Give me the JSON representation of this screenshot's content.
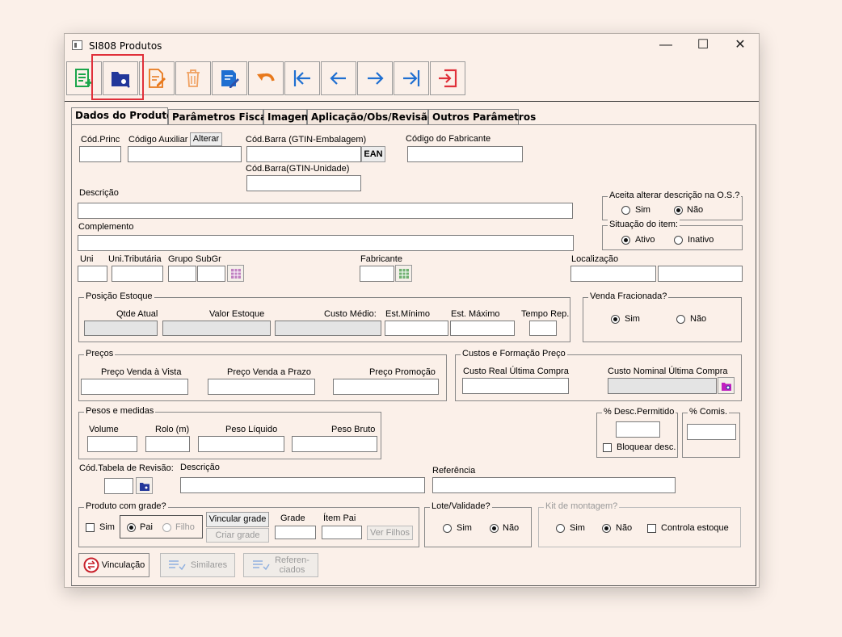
{
  "window": {
    "title": "SI808 Produtos",
    "minimize": "—",
    "maximize": "☐",
    "close": "✕"
  },
  "toolbar": {
    "icons": [
      "new-icon",
      "search-folder-icon",
      "edit-icon",
      "delete-icon",
      "edit-save-icon",
      "undo-icon",
      "first-icon",
      "previous-icon",
      "next-icon",
      "last-icon",
      "exit-icon"
    ]
  },
  "tabs": [
    "Dados do  Produto",
    "Parâmetros Fiscais",
    "Imagem",
    "Aplicação/Obs/Revisão",
    "Outros Parâmetros"
  ],
  "top": {
    "cod_princ": "Cód.Princ",
    "cod_aux": "Código Auxiliar",
    "alterar": "Alterar",
    "cod_barra_emb": "Cód.Barra (GTIN-Embalagem)",
    "ean": "EAN",
    "cod_barra_uni": "Cód.Barra(GTIN-Unidade)",
    "cod_fabricante": "Código do Fabricante",
    "descricao": "Descrição",
    "complemento": "Complemento"
  },
  "aceita": {
    "title": "Aceita alterar descrição na O.S.?",
    "sim": "Sim",
    "nao": "Não"
  },
  "situacao": {
    "title": "Situação do item:",
    "ativo": "Ativo",
    "inativo": "Inativo"
  },
  "row3": {
    "uni": "Uni",
    "uni_trib": "Uni.Tributária",
    "grupo": "Grupo",
    "subgr": "SubGr",
    "fabricante": "Fabricante",
    "localizacao": "Localização"
  },
  "estoque": {
    "title": "Posição Estoque",
    "qtde": "Qtde Atual",
    "valor": "Valor Estoque",
    "custo_medio": "Custo Médio:",
    "est_min": "Est.Mínimo",
    "est_max": "Est. Máximo",
    "tempo_rep": "Tempo Rep."
  },
  "venda_frac": {
    "title": "Venda Fracionada?",
    "sim": "Sim",
    "nao": "Não"
  },
  "precos": {
    "title": "Preços",
    "vista": "Preço Venda à Vista",
    "prazo": "Preço Venda a Prazo",
    "promo": "Preço Promoção"
  },
  "custos": {
    "title": "Custos e Formação Preço",
    "real": "Custo Real Última Compra",
    "nominal": "Custo Nominal Última Compra"
  },
  "pesos": {
    "title": "Pesos e medidas",
    "volume": "Volume",
    "rolo": "Rolo (m)",
    "liquido": "Peso Líquido",
    "bruto": "Peso Bruto"
  },
  "desc_perm": {
    "title": "% Desc.Permitido",
    "bloquear": "Bloquear desc."
  },
  "comis": {
    "title": "% Comis."
  },
  "revisao": {
    "cod_tabela": "Cód.Tabela de Revisão:",
    "descricao": "Descrição",
    "referencia": "Referência"
  },
  "grade": {
    "title": "Produto com grade?",
    "sim": "Sim",
    "pai": "Pai",
    "filho": "Filho",
    "vincular": "Vincular grade",
    "criar": "Criar grade",
    "grade": "Grade",
    "item_pai": "Ítem Pai",
    "ver_filhos": "Ver Filhos"
  },
  "lote": {
    "title": "Lote/Validade?",
    "sim": "Sim",
    "nao": "Não"
  },
  "kit": {
    "title": "Kit de montagem?",
    "sim": "Sim",
    "nao": "Não",
    "controla": "Controla estoque"
  },
  "bottom": {
    "vinculacao": "Vinculação",
    "similares": "Similares",
    "referenciados": "Referen-\nciados"
  },
  "colors": {
    "accent_red": "#e0303a",
    "green": "#1aa54a",
    "blue": "#1f6fd1",
    "orange": "#e8791c",
    "navy": "#22379a"
  }
}
